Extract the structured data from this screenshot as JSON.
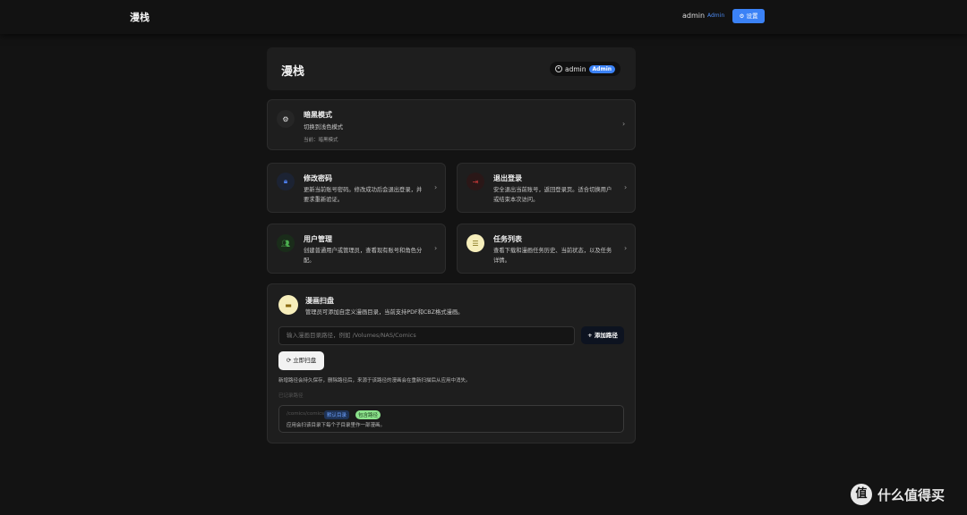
{
  "topbar": {
    "brand": "漫栈",
    "user": "admin",
    "role": "Admin",
    "settings_label": "⚙ 设置"
  },
  "header": {
    "title": "漫栈",
    "user": "admin",
    "badge": "Admin"
  },
  "dark_mode": {
    "title": "暗黑模式",
    "desc": "切换到浅色模式",
    "current": "当前：暗黑模式",
    "icon": "gear-icon"
  },
  "change_password": {
    "title": "修改密码",
    "desc_line1": "更新当前账号密码。修改成功后会退出登录，并",
    "desc_line2": "要求重新验证。",
    "icon": "lock-icon"
  },
  "logout": {
    "title": "退出登录",
    "desc_line1": "安全退出当前账号，返回登录页。适合切换用户",
    "desc_line2": "或结束本次访问。",
    "icon": "logout-icon"
  },
  "user_management": {
    "title": "用户管理",
    "desc_line1": "创建普通用户或管理员，查看现有账号和角色分",
    "desc_line2": "配。",
    "icon": "users-icon"
  },
  "task_list": {
    "title": "任务列表",
    "desc_line1": "查看下载和漫画任务历史、当前状态，以及任务",
    "desc_line2": "详情。",
    "icon": "list-icon"
  },
  "comic_scan": {
    "title": "漫画扫盘",
    "desc": "管理员可添加自定义漫画目录，当前支持PDF和CBZ格式漫画。",
    "icon": "folder-icon",
    "input_placeholder": "输入漫画目录路径，例如 /Volumes/NAS/Comics",
    "add_label": "+ 添加路径",
    "scan_label": "⟳ 立即扫盘",
    "note": "新增路径会持久保存，删除路径后，来源于该路径的漫画会在重新扫描后从应用中消失。",
    "section_label": "已记录路径",
    "entry": {
      "path": "/comics/comics",
      "tag_blue": "默认目录",
      "tag_green": "包含路径",
      "desc": "应用会扫该目录下每个子目录里作一部漫画。"
    }
  },
  "watermark": {
    "text": "什么值得买",
    "logo": "值"
  }
}
